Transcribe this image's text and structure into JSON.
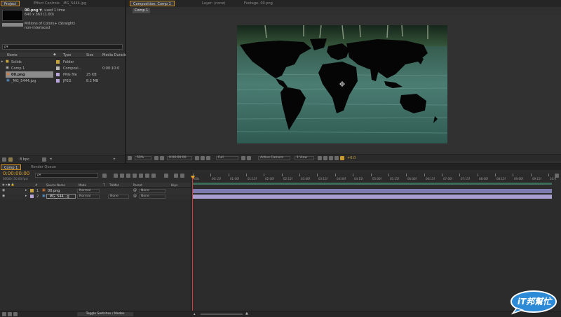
{
  "project": {
    "tabs": [
      {
        "label": "Project"
      },
      {
        "label": "Effect Controls: _MG_5444.jpg"
      }
    ],
    "preview": {
      "name": "00.png",
      "used": "▼, used 1 time",
      "dims": "640 x 363 (1.00)",
      "colors": "Millions of Colors+ (Straight)",
      "interlace": "non-interlaced"
    },
    "search_placeholder": "ρ▾",
    "columns": {
      "name": "Name",
      "type": "Type",
      "size": "Size",
      "duration": "Media Duration"
    },
    "items": [
      {
        "name": "Solids",
        "type": "Folder",
        "size": "",
        "duration": "",
        "color": "#c8a23c"
      },
      {
        "name": "Comp 1",
        "type": "Composi...",
        "size": "",
        "duration": "0:00:10:0",
        "color": "#b9b9b9"
      },
      {
        "name": "00.png",
        "type": "PNG file",
        "size": "25 KB",
        "duration": "",
        "color": "#b7a5d9"
      },
      {
        "name": "_MG_5444.jpg",
        "type": "JPEG",
        "size": "8.2 MB",
        "duration": "",
        "color": "#b7a5d9"
      }
    ],
    "bpc": "8 bpc"
  },
  "composition": {
    "tabs": [
      {
        "label": "Composition: Comp 1"
      },
      {
        "label": "Layer: (none)"
      },
      {
        "label": "Footage: 00.png"
      }
    ],
    "subtab": "Comp 1",
    "toolbar": {
      "zoom": "50%",
      "timecode": "0:00:00:00",
      "resolution": "Full",
      "camera": "Active Camera",
      "view": "1 View",
      "exposure": "+0.0"
    }
  },
  "timeline": {
    "tabs": [
      {
        "label": "Comp 1"
      },
      {
        "label": "Render Queue"
      }
    ],
    "timecode": "0:00:00:00",
    "frames": "00000 (30.00 fps)",
    "search_placeholder": "ρ▾",
    "columns": {
      "num": "#",
      "source": "Source Name",
      "mode": "Mode",
      "t": "T",
      "trkmat": "TrkMat",
      "parent": "Parent",
      "keys": "Keys"
    },
    "layers": [
      {
        "num": "1",
        "name": "00.png",
        "mode": "Normal",
        "trkmat": "",
        "parent": "None",
        "color": "#c8a23c"
      },
      {
        "num": "2",
        "name": "_MG_544...g",
        "mode": "Normal",
        "trkmat": "None",
        "parent": "None",
        "color": "#b7a5d9"
      }
    ],
    "ruler": [
      "00s",
      "00:15f",
      "01:00f",
      "01:15f",
      "02:00f",
      "02:15f",
      "03:00f",
      "03:15f",
      "04:00f",
      "04:15f",
      "05:00f",
      "05:15f",
      "06:00f",
      "06:15f",
      "07:00f",
      "07:15f",
      "08:00f",
      "08:15f",
      "09:00f",
      "09:15f",
      "10:0"
    ],
    "toggle_label": "Toggle Switches / Modes"
  },
  "watermark": {
    "text": "iT邦幫忙"
  },
  "colors": {
    "accent_orange": "#d28f1e",
    "work_area": "#3d6b57",
    "layer1_bar": "#7d7bb0",
    "layer2_bar": "#a89ed0",
    "playhead": "#d33c3c"
  }
}
